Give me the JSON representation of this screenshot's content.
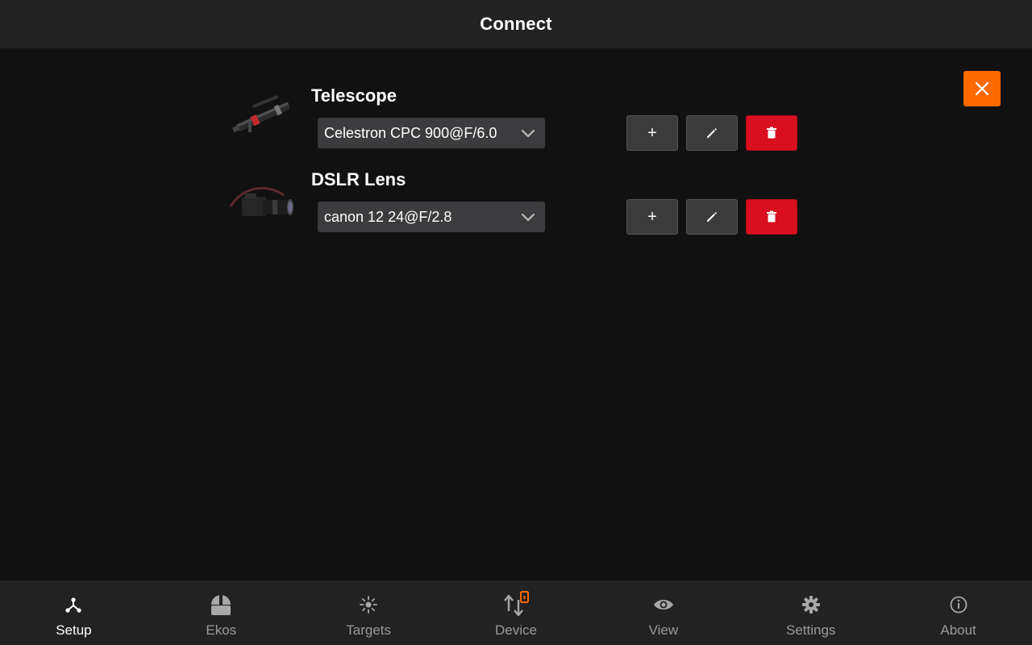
{
  "header": {
    "title": "Connect"
  },
  "main": {
    "close_icon": "close-icon",
    "equipment": [
      {
        "label": "Telescope",
        "image_icon": "telescope-image",
        "selected": "Celestron CPC 900@F/6.0",
        "buttons": {
          "add_label": "+",
          "edit_icon": "pencil-icon",
          "delete_icon": "trash-icon"
        }
      },
      {
        "label": "DSLR Lens",
        "image_icon": "dslr-lens-image",
        "selected": "canon 12 24@F/2.8",
        "buttons": {
          "add_label": "+",
          "edit_icon": "pencil-icon",
          "delete_icon": "trash-icon"
        }
      }
    ]
  },
  "bottom_nav": {
    "items": [
      {
        "label": "Setup",
        "icon": "setup-icon",
        "active": true
      },
      {
        "label": "Ekos",
        "icon": "observatory-dome-icon",
        "active": false
      },
      {
        "label": "Targets",
        "icon": "sun-target-icon",
        "active": false
      },
      {
        "label": "Device",
        "icon": "device-transfer-icon",
        "active": false
      },
      {
        "label": "View",
        "icon": "eye-icon",
        "active": false
      },
      {
        "label": "Settings",
        "icon": "gear-icon",
        "active": false
      },
      {
        "label": "About",
        "icon": "info-icon",
        "active": false
      }
    ]
  },
  "colors": {
    "accent": "#ff6a00",
    "danger": "#d90f1f",
    "header_bg": "#222223",
    "content_bg": "#111112",
    "button_gray": "#3b3b3c"
  }
}
